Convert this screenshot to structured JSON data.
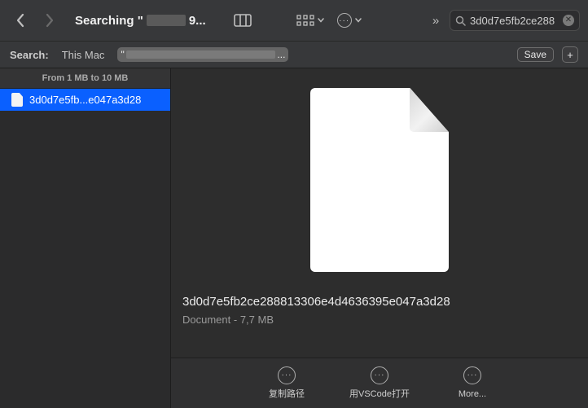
{
  "toolbar": {
    "back_disabled": false,
    "forward_disabled": true,
    "title_prefix": "Searching \"",
    "title_suffix": "9...",
    "overflow": "»"
  },
  "search": {
    "value": "3d0d7e5fb2ce288"
  },
  "scope": {
    "label": "Search:",
    "this_mac": "This Mac",
    "path_leading": "\"",
    "path_trailing": "...",
    "save": "Save",
    "plus": "+"
  },
  "filter": {
    "label": "From 1 MB to 10 MB"
  },
  "sidebar": {
    "items": [
      {
        "label": "3d0d7e5fb...e047a3d28"
      }
    ]
  },
  "preview": {
    "filename": "3d0d7e5fb2ce288813306e4d4636395e047a3d28",
    "kind": "Document",
    "size": "7,7 MB"
  },
  "actions": {
    "copy_path": "复制路径",
    "open_vscode": "用VSCode打开",
    "more": "More..."
  }
}
